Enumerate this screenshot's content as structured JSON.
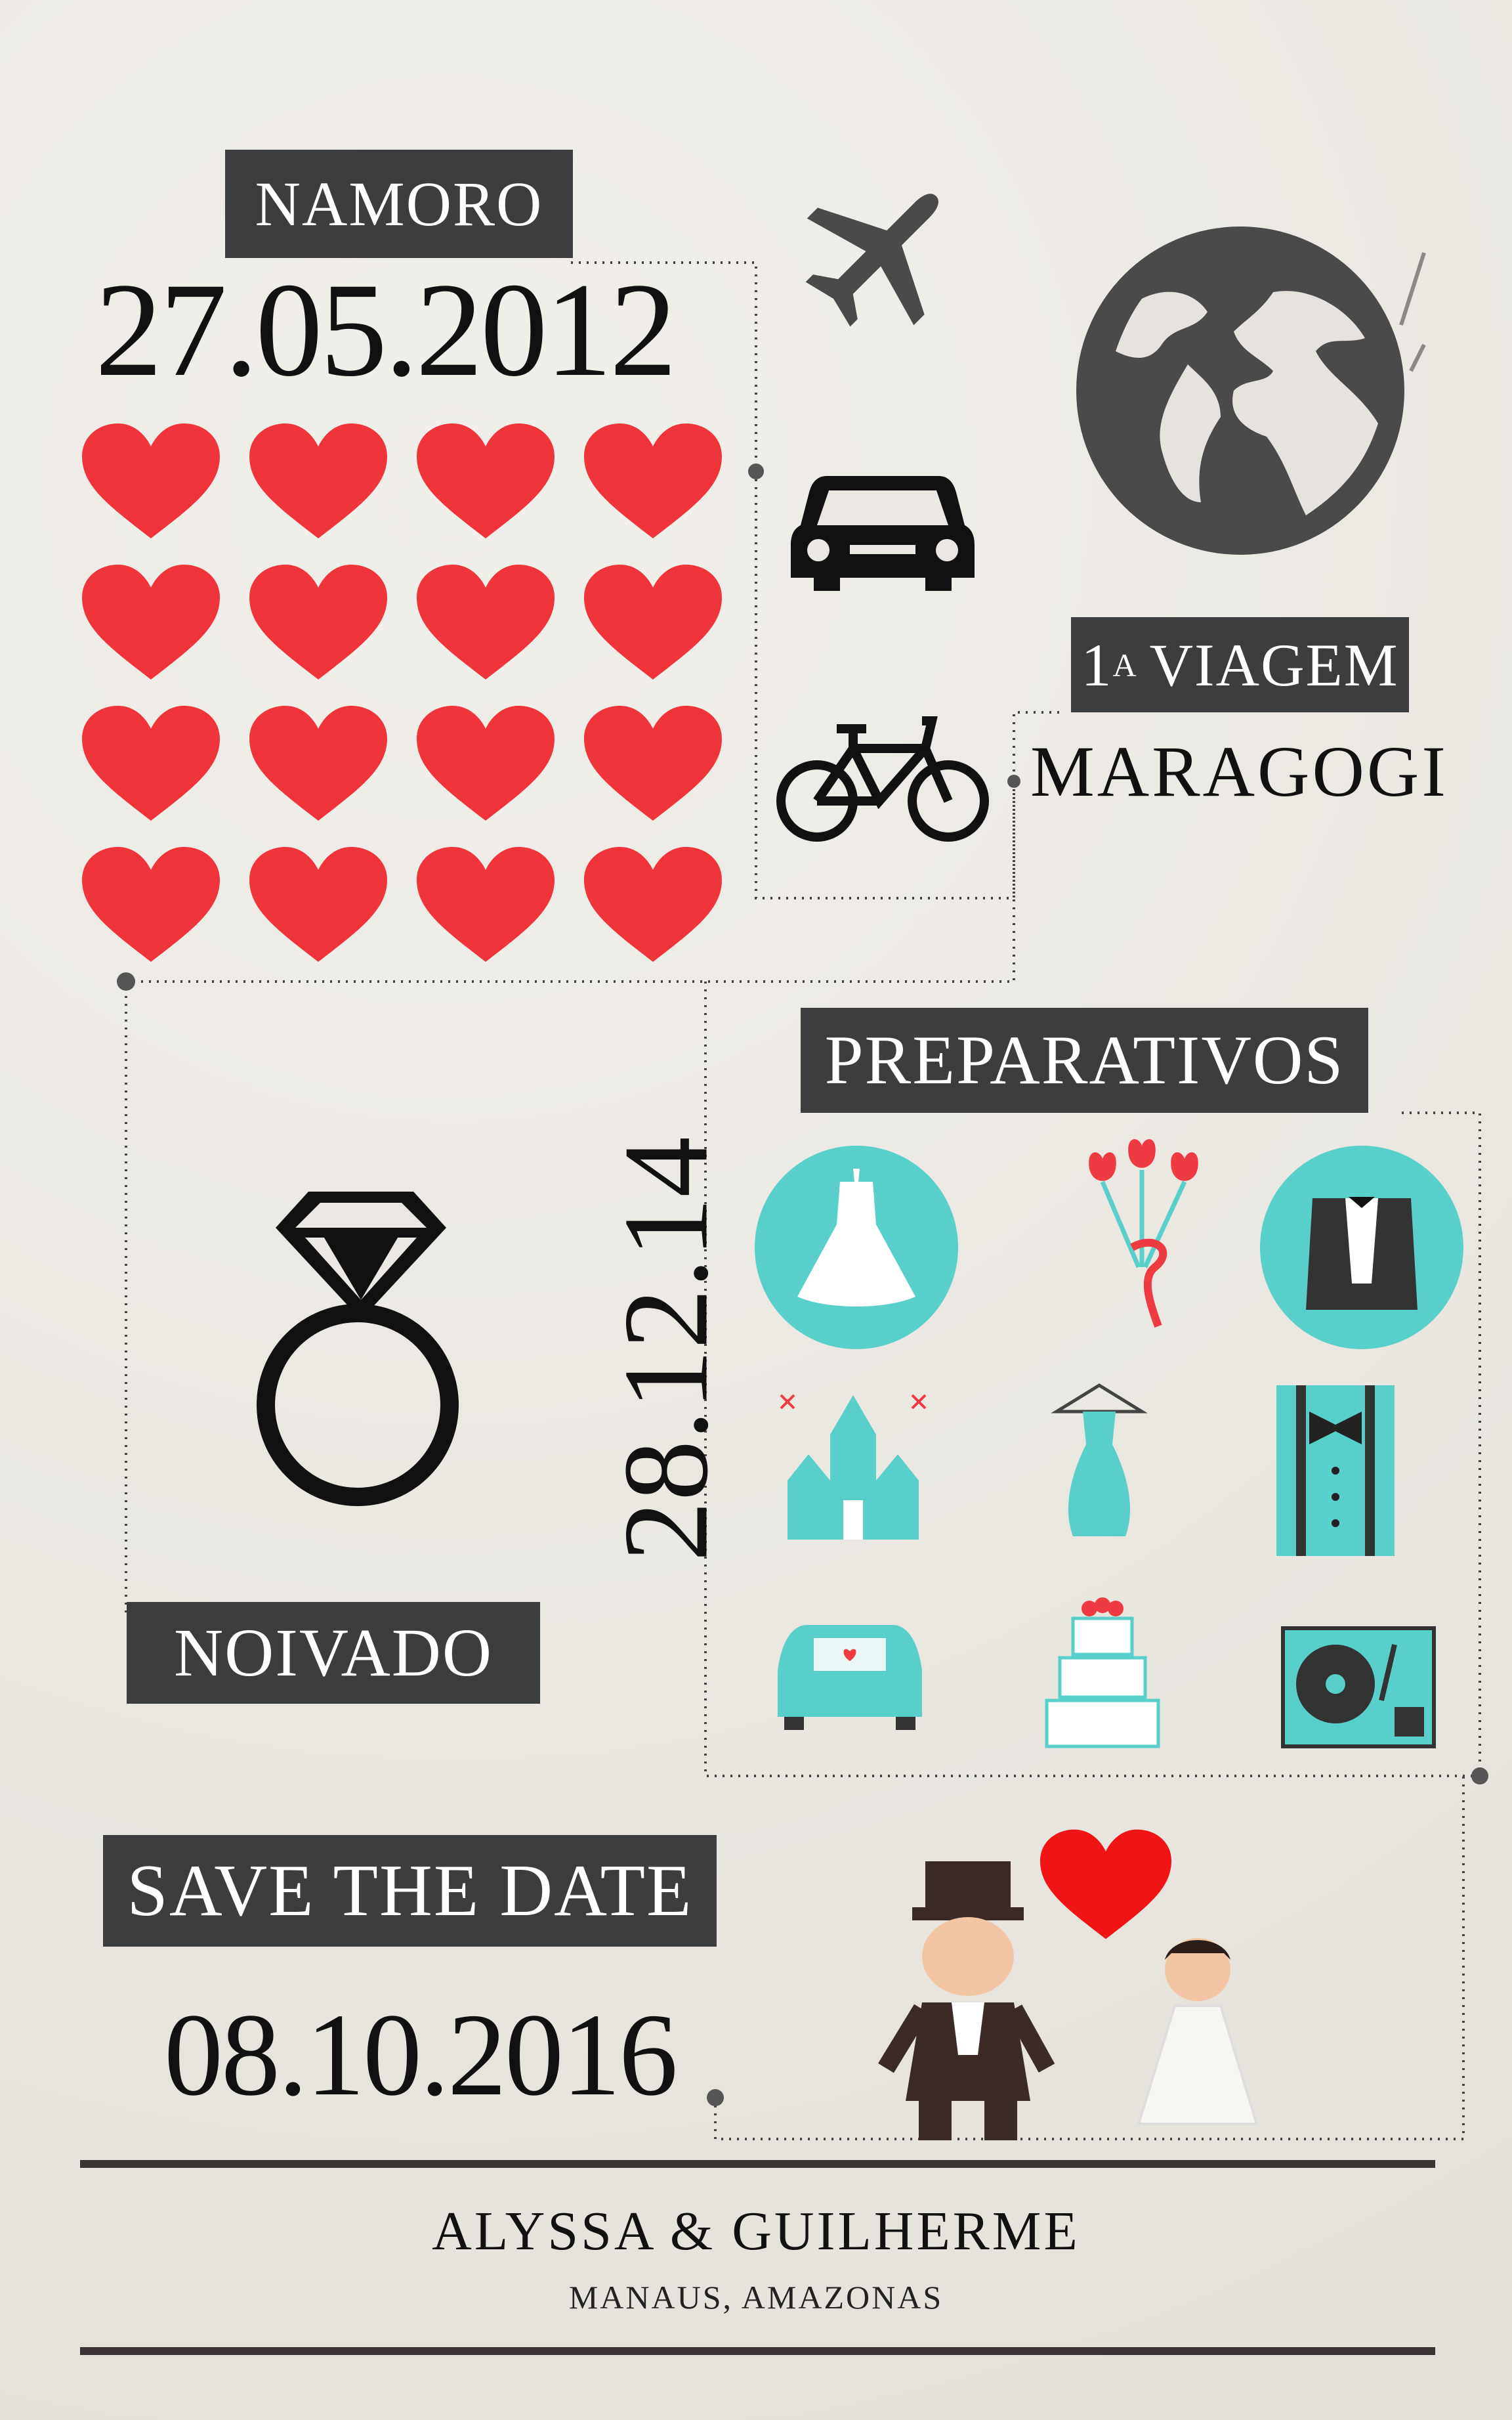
{
  "namoro": {
    "label": "Namoro",
    "date": "27.05.2012"
  },
  "viagem": {
    "label_num": "1",
    "label_sup": "A",
    "label_rest": "Viagem",
    "place": "Maragogi"
  },
  "noivado": {
    "label": "Noivado",
    "date": "28.12.14"
  },
  "preparativos": {
    "label": "Preparativos"
  },
  "save": {
    "label": "Save the date",
    "date": "08.10.2016"
  },
  "footer": {
    "names": "Alyssa & Guilherme",
    "location": "Manaus, Amazonas"
  },
  "colors": {
    "box": "#3c3d3e",
    "heart": "#f0353a",
    "teal": "#59cfca",
    "ink": "#111111",
    "icon": "#4a4a4a"
  },
  "icons": [
    "airplane-icon",
    "globe-icon",
    "car-icon",
    "bicycle-icon",
    "ring-icon",
    "dress-icon",
    "tulips-icon",
    "tuxedo-icon",
    "church-icon",
    "hanger-dress-icon",
    "suspenders-icon",
    "wedding-car-icon",
    "cake-icon",
    "turntable-icon",
    "groom-icon",
    "bride-icon"
  ]
}
